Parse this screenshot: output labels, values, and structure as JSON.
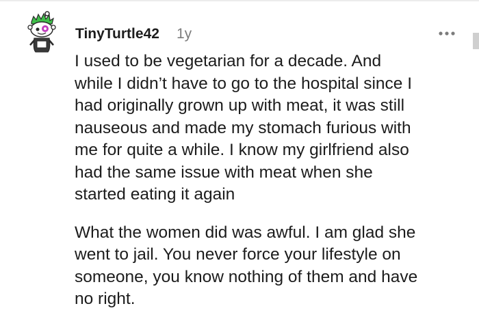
{
  "comment": {
    "username": "TinyTurtle42",
    "timestamp": "1y",
    "paragraphs": [
      "I used to be vegetarian for a decade. And\nwhile I didn’t have to go to the hospital since I\nhad originally grown up with meat, it was still\nnauseous and made my stomach furious with\nme for quite a while. I know my girlfriend also\nhad the same issue with meat when she\nstarted eating it again",
      "What the women did was awful. I am glad she\nwent to jail. You never force your lifestyle on\nsomeone, you know nothing of them and have\nno right."
    ]
  },
  "icons": {
    "avatar": "snoo-avatar-icon",
    "more": "more-options-icon"
  },
  "colors": {
    "text": "#1c1c1c",
    "meta": "#7c7c7c",
    "avatar_hair": "#3fbf4a",
    "avatar_eye": "#c23fbf"
  }
}
